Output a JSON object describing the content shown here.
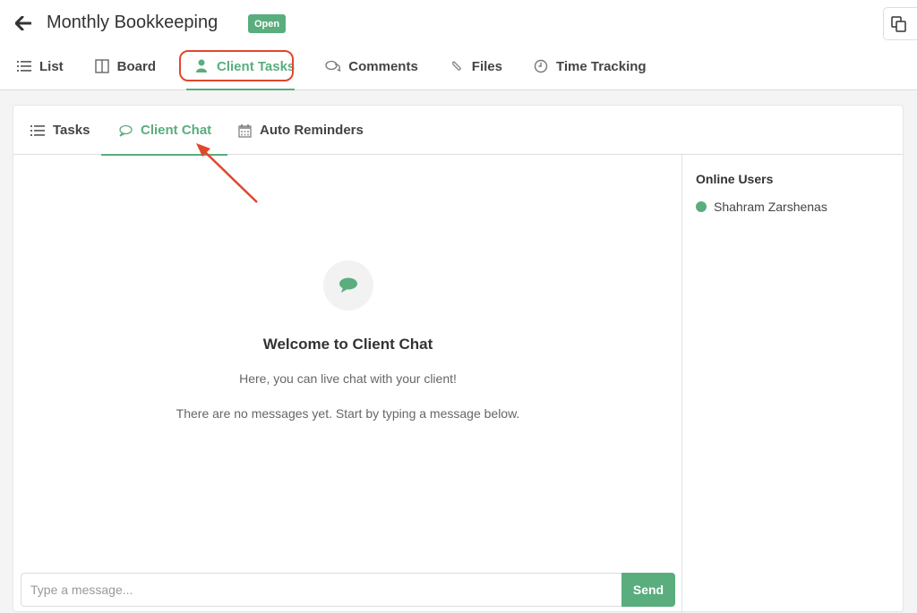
{
  "header": {
    "title": "Monthly Bookkeeping",
    "status_badge": "Open",
    "status_color": "#5aad7d"
  },
  "nav": {
    "tabs": [
      {
        "label": "List",
        "icon": "list-icon"
      },
      {
        "label": "Board",
        "icon": "board-icon"
      },
      {
        "label": "Client Tasks",
        "icon": "user-icon",
        "active": true
      },
      {
        "label": "Comments",
        "icon": "comments-icon"
      },
      {
        "label": "Files",
        "icon": "paperclip-icon"
      },
      {
        "label": "Time Tracking",
        "icon": "clock-icon"
      }
    ]
  },
  "subtabs": [
    {
      "label": "Tasks",
      "icon": "list-icon"
    },
    {
      "label": "Client Chat",
      "icon": "chat-bubble-icon",
      "active": true
    },
    {
      "label": "Auto Reminders",
      "icon": "calendar-icon"
    }
  ],
  "chat": {
    "welcome_title": "Welcome to Client Chat",
    "welcome_subtitle": "Here, you can live chat with your client!",
    "empty_message": "There are no messages yet. Start by typing a message below.",
    "input_placeholder": "Type a message...",
    "input_value": "",
    "send_label": "Send"
  },
  "online_users": {
    "title": "Online Users",
    "users": [
      {
        "name": "Shahram Zarshenas",
        "status": "online"
      }
    ]
  },
  "colors": {
    "accent": "#5aad7d",
    "annotation": "#e0472c"
  }
}
